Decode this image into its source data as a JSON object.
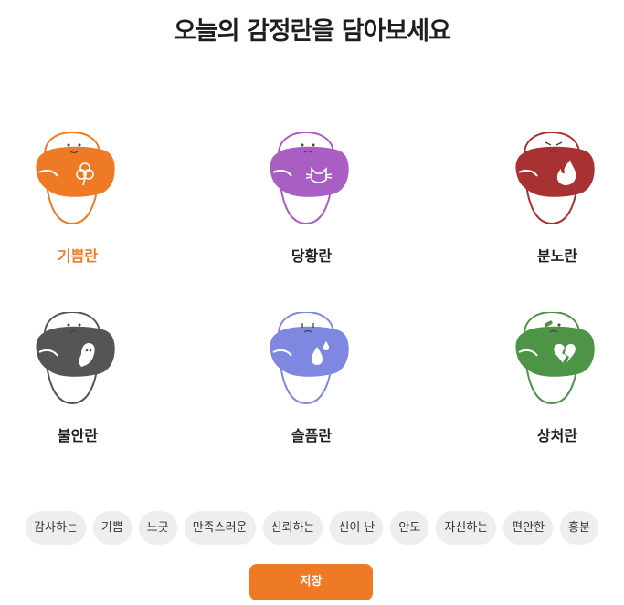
{
  "title": "오늘의 감정란을 담아보세요",
  "emotions": [
    {
      "label": "기쁨란",
      "color": "#ee7a25",
      "icon": "clover-icon",
      "selected": true
    },
    {
      "label": "당황란",
      "color": "#a85ec2",
      "icon": "cat-icon",
      "selected": false
    },
    {
      "label": "분노란",
      "color": "#a83232",
      "icon": "fire-icon",
      "selected": false
    },
    {
      "label": "불안란",
      "color": "#555555",
      "icon": "ghost-icon",
      "selected": false
    },
    {
      "label": "슬픔란",
      "color": "#7e88e0",
      "icon": "droplets-icon",
      "selected": false
    },
    {
      "label": "상처란",
      "color": "#4e9446",
      "icon": "broken-heart-icon",
      "selected": false
    }
  ],
  "chips": [
    "감사하는",
    "기쁨",
    "느긋",
    "만족스러운",
    "신뢰하는",
    "신이 난",
    "안도",
    "자신하는",
    "편안한",
    "흥분"
  ],
  "save_label": "저장"
}
